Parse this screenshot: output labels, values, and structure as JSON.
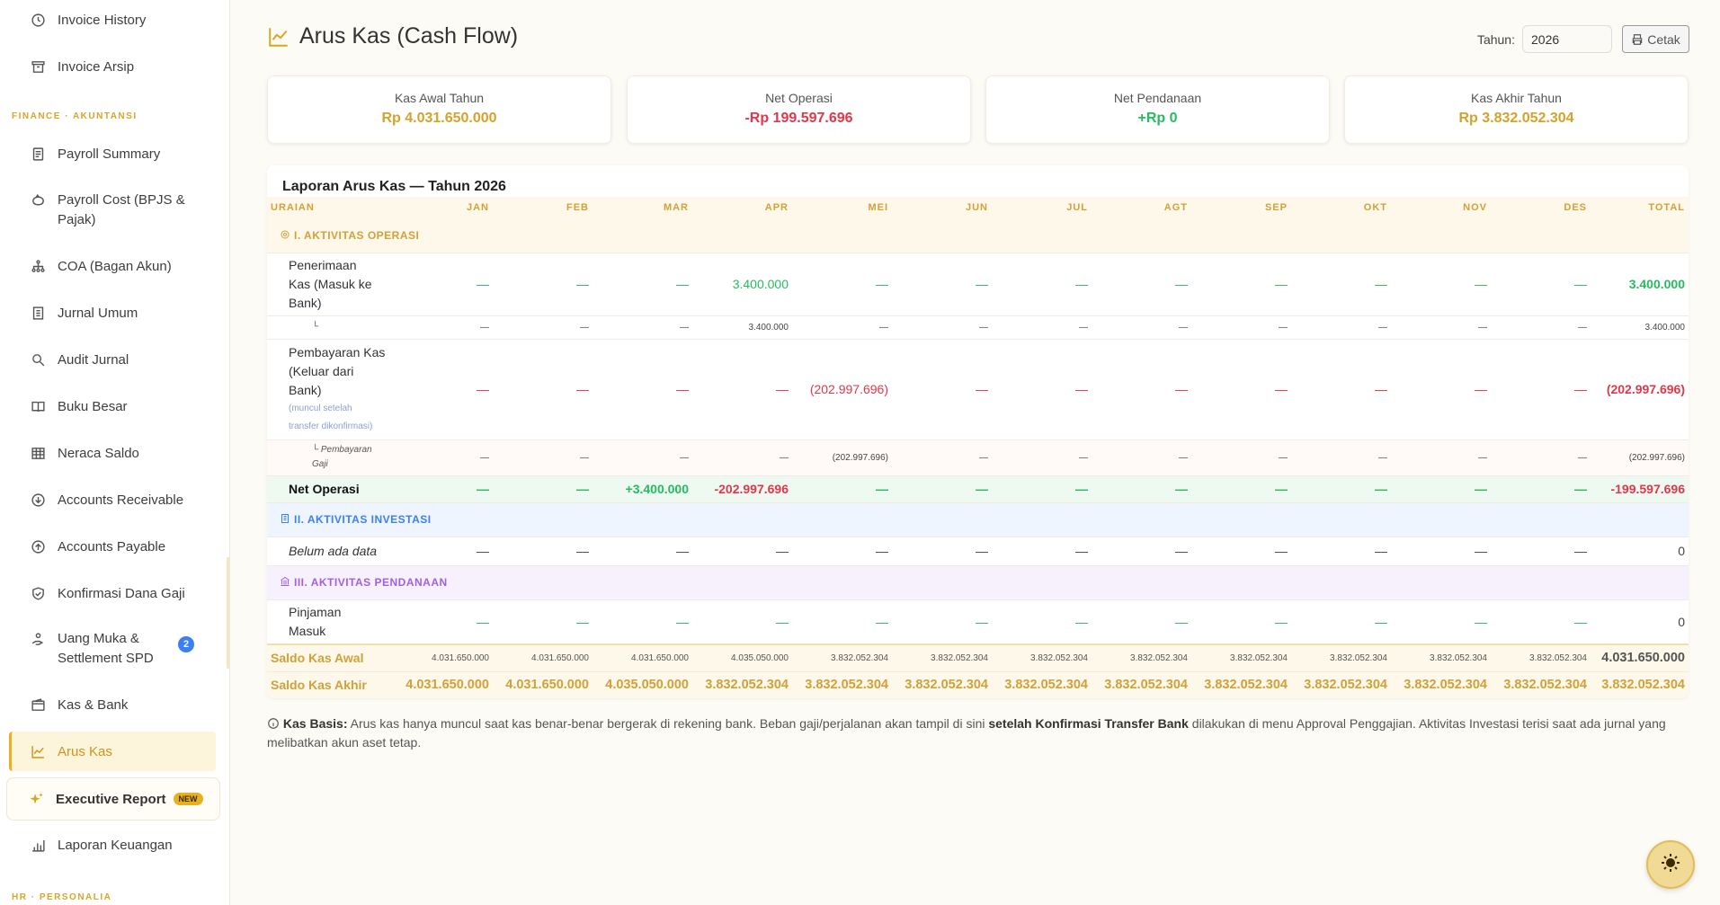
{
  "sidebar": {
    "items_top": [
      {
        "label": "Invoice History",
        "icon": "clock-icon"
      },
      {
        "label": "Invoice Arsip",
        "icon": "archive-icon"
      }
    ],
    "section_finance": "FINANCE · AKUNTANSI",
    "items_finance": [
      {
        "label": "Payroll Summary",
        "icon": "document-icon"
      },
      {
        "label": "Payroll Cost (BPJS & Pajak)",
        "icon": "piggy-bank-icon"
      },
      {
        "label": "COA (Bagan Akun)",
        "icon": "hierarchy-icon"
      },
      {
        "label": "Jurnal Umum",
        "icon": "journal-icon"
      },
      {
        "label": "Audit Jurnal",
        "icon": "magnifier-icon"
      },
      {
        "label": "Buku Besar",
        "icon": "book-icon"
      },
      {
        "label": "Neraca Saldo",
        "icon": "table-icon"
      },
      {
        "label": "Accounts Receivable",
        "icon": "arrow-down-circle-icon"
      },
      {
        "label": "Accounts Payable",
        "icon": "arrow-up-circle-icon"
      },
      {
        "label": "Konfirmasi Dana Gaji",
        "icon": "shield-check-icon"
      },
      {
        "label": "Uang Muka & Settlement SPD",
        "icon": "hand-coin-icon",
        "badge": "2"
      },
      {
        "label": "Kas & Bank",
        "icon": "wallet-icon"
      },
      {
        "label": "Arus Kas",
        "icon": "line-chart-icon",
        "active": true
      },
      {
        "label": "Executive Report",
        "icon": "sparkle-icon",
        "tag": "NEW"
      },
      {
        "label": "Laporan Keuangan",
        "icon": "bar-chart-icon"
      }
    ],
    "section_hr": "HR · PERSONALIA"
  },
  "header": {
    "title": "Arus Kas (Cash Flow)",
    "year_label": "Tahun:",
    "year_value": "2026",
    "print_label": "Cetak"
  },
  "cards": [
    {
      "label": "Kas Awal Tahun",
      "value": "Rp 4.031.650.000",
      "color": "#d6a22a"
    },
    {
      "label": "Net Operasi",
      "value": "-Rp 199.597.696",
      "color": "#e0384a"
    },
    {
      "label": "Net Pendanaan",
      "value": "+Rp 0",
      "color": "#25bb5e"
    },
    {
      "label": "Kas Akhir Tahun",
      "value": "Rp 3.832.052.304",
      "color": "#d6a22a"
    }
  ],
  "report": {
    "title": "Laporan Arus Kas — Tahun 2026",
    "columns": [
      "URAIAN",
      "JAN",
      "FEB",
      "MAR",
      "APR",
      "MEI",
      "JUN",
      "JUL",
      "AGT",
      "SEP",
      "OKT",
      "NOV",
      "DES",
      "TOTAL"
    ],
    "sections": {
      "operasi": "I. AKTIVITAS OPERASI",
      "investasi": "II. AKTIVITAS INVESTASI",
      "pendanaan": "III. AKTIVITAS PENDANAAN"
    },
    "rows": {
      "penerimaan": {
        "label": "Penerimaan Kas (Masuk ke Bank)",
        "values": [
          "—",
          "—",
          "—",
          "3.400.000",
          "—",
          "—",
          "—",
          "—",
          "—",
          "—",
          "—",
          "—",
          "3.400.000"
        ]
      },
      "penerimaan_sub": {
        "label": "└",
        "values": [
          "—",
          "—",
          "—",
          "3.400.000",
          "—",
          "—",
          "—",
          "—",
          "—",
          "—",
          "—",
          "—",
          "3.400.000"
        ]
      },
      "pembayaran": {
        "label": "Pembayaran Kas (Keluar dari Bank)",
        "note": "(muncul setelah transfer dikonfirmasi)",
        "values": [
          "—",
          "—",
          "—",
          "—",
          "(202.997.696)",
          "—",
          "—",
          "—",
          "—",
          "—",
          "—",
          "—",
          "(202.997.696)"
        ]
      },
      "pembayaran_sub": {
        "label": "└ Pembayaran Gaji",
        "values": [
          "—",
          "—",
          "—",
          "—",
          "(202.997.696)",
          "—",
          "—",
          "—",
          "—",
          "—",
          "—",
          "—",
          "(202.997.696)"
        ]
      },
      "net_operasi": {
        "label": "Net Operasi",
        "values": [
          "—",
          "—",
          "+3.400.000",
          "-202.997.696",
          "—",
          "—",
          "—",
          "—",
          "—",
          "—",
          "—",
          "—",
          "-199.597.696"
        ]
      },
      "investasi_empty": {
        "label": "Belum ada data",
        "values": [
          "—",
          "—",
          "—",
          "—",
          "—",
          "—",
          "—",
          "—",
          "—",
          "—",
          "—",
          "—",
          "0"
        ]
      },
      "pinjaman": {
        "label": "Pinjaman Masuk",
        "values": [
          "—",
          "—",
          "—",
          "—",
          "—",
          "—",
          "—",
          "—",
          "—",
          "—",
          "—",
          "—",
          "0"
        ]
      },
      "saldo_awal": {
        "label": "Saldo Kas Awal",
        "values": [
          "4.031.650.000",
          "4.031.650.000",
          "4.031.650.000",
          "4.035.050.000",
          "3.832.052.304",
          "3.832.052.304",
          "3.832.052.304",
          "3.832.052.304",
          "3.832.052.304",
          "3.832.052.304",
          "3.832.052.304",
          "3.832.052.304",
          "4.031.650.000"
        ]
      },
      "saldo_akhir": {
        "label": "Saldo Kas Akhir",
        "values": [
          "4.031.650.000",
          "4.031.650.000",
          "4.035.050.000",
          "3.832.052.304",
          "3.832.052.304",
          "3.832.052.304",
          "3.832.052.304",
          "3.832.052.304",
          "3.832.052.304",
          "3.832.052.304",
          "3.832.052.304",
          "3.832.052.304",
          "3.832.052.304"
        ]
      }
    }
  },
  "footnote": {
    "lead": "Kas Basis:",
    "text1": " Arus kas hanya muncul saat kas benar-benar bergerak di rekening bank. Beban gaji/perjalanan akan tampil di sini ",
    "bold": "setelah Konfirmasi Transfer Bank",
    "text2": " dilakukan di menu Approval Penggajian. Aktivitas Investasi terisi saat ada jurnal yang melibatkan akun aset tetap."
  },
  "colors": {
    "accent": "#d6a22a",
    "negative": "#e0384a",
    "positive": "#25bb5e",
    "investasi": "#3b7ff5",
    "pendanaan": "#a35fe3"
  }
}
